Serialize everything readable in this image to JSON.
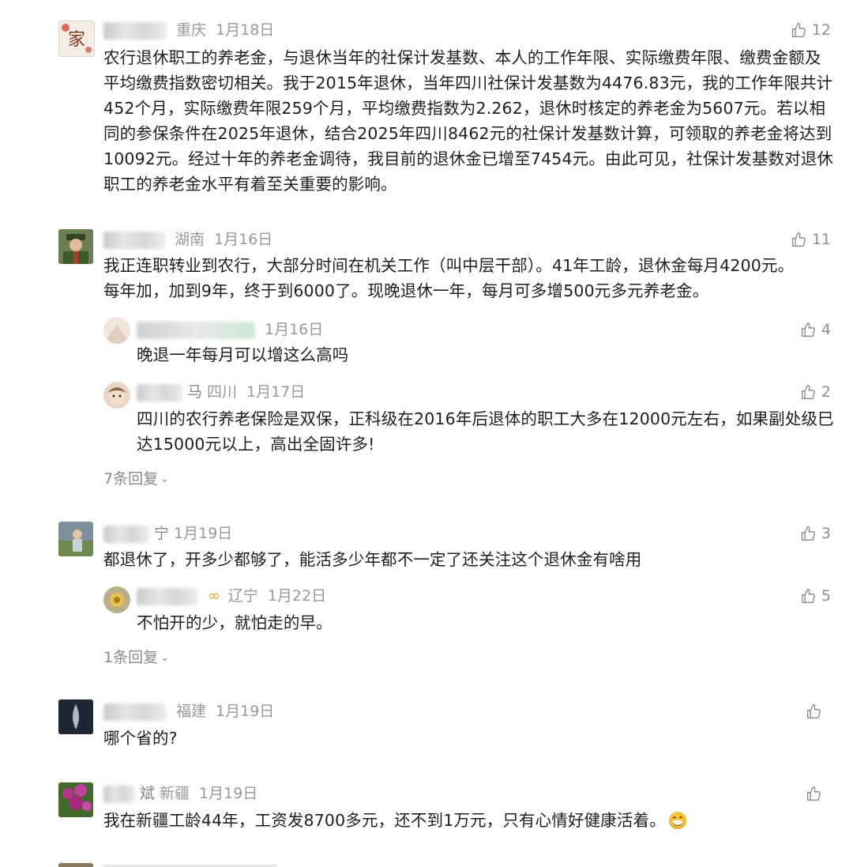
{
  "comments": [
    {
      "name_tail": "",
      "region": "重庆",
      "date": "1月18日",
      "likes": "12",
      "text": "农行退休职工的养老金，与退休当年的社保计发基数、本人的工作年限、实际缴费年限、缴费金额及平均缴费指数密切相关。我于2015年退休，当年四川社保计发基数为4476.83元，我的工作年限共计452个月，实际缴费年限259个月，平均缴费指数为2.262，退休时核定的养老金为5607元。若以相同的参保条件在2025年退休，结合2025年四川8462元的社保计发基数计算，可领取的养老金将达到10092元。经过十年的养老金调待，我目前的退休金已增至7454元。由此可见，社保计发基数对退休职工的养老金水平有着至关重要的影响。",
      "avatar_char": "家"
    },
    {
      "name_tail": "",
      "region": "湖南",
      "date": "1月16日",
      "likes": "11",
      "text": "我正连职转业到农行，大部分时间在机关工作（叫中层干部）。41年工龄，退休金每月4200元。每年加，加到9年，终于到6000了。现晚退休一年，每月可多增500元多元养老金。",
      "replies": [
        {
          "name_tail": "",
          "region": "",
          "date": "1月16日",
          "likes": "4",
          "text": "晚退一年每月可以增这么高吗"
        },
        {
          "name_tail": "马",
          "region": "四川",
          "date": "1月17日",
          "likes": "2",
          "text": "四川的农行养老保险是双保，正科级在2016年后退体的职工大多在12000元左右，如果副处级巳达15000元以上，高出全固许多!"
        }
      ],
      "more_replies": "7条回复"
    },
    {
      "name_tail": "宁",
      "region": "",
      "date": "1月19日",
      "likes": "3",
      "text": "都退休了，开多少都够了，能活多少年都不一定了还关注这个退休金有啥用",
      "replies": [
        {
          "name_tail": "",
          "region": "辽宁",
          "date": "1月22日",
          "likes": "5",
          "text": "不怕开的少，就怕走的早。"
        }
      ],
      "more_replies": "1条回复"
    },
    {
      "name_tail": "",
      "region": "福建",
      "date": "1月19日",
      "likes": "",
      "text": "哪个省的?"
    },
    {
      "name_tail": "斌",
      "region": "新疆",
      "date": "1月19日",
      "likes": "",
      "text": "我在新疆工龄44年，工资发8700多元，还不到1万元，只有心情好健康活着。"
    }
  ],
  "icons": {
    "like": "thumbs-up-icon",
    "chevron": "chevron-down-icon",
    "emoji": "grinning-face-icon"
  },
  "colors": {
    "meta": "#999999",
    "text": "#1f1f1f",
    "background": "#ffffff"
  }
}
